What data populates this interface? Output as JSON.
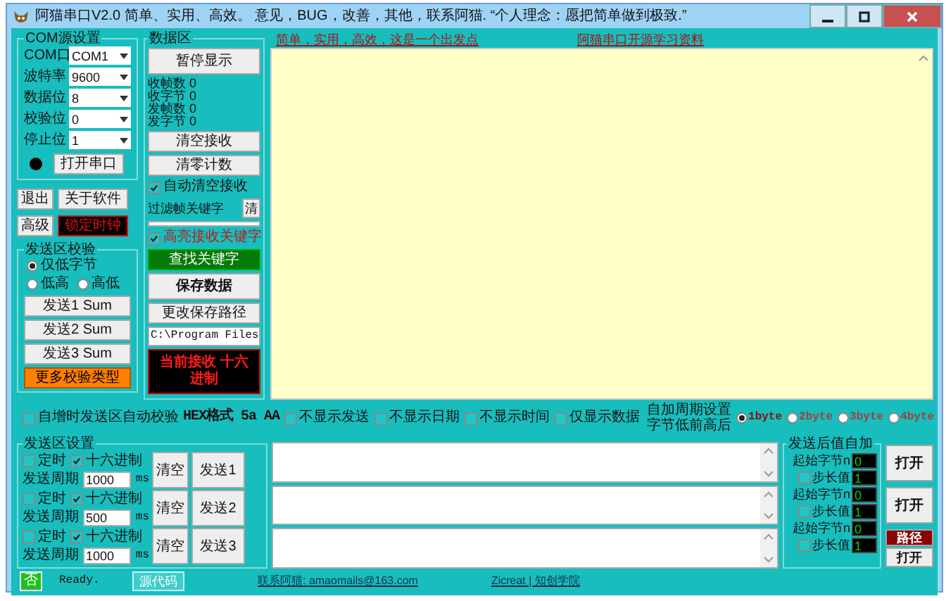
{
  "window": {
    "title": "阿猫串口V2.0  简单、实用、高效。  意见，BUG，改善，其他，联系阿猫. “个人理念：愿把简单做到极致.”"
  },
  "header_links": [
    "简单，实用，高效，这是一个出发点",
    "阿猫串口开源学习资料"
  ],
  "com_settings": {
    "title": "COM源设置",
    "fields": [
      {
        "label": "COM口",
        "value": "COM1"
      },
      {
        "label": "波特率",
        "value": "9600"
      },
      {
        "label": "数据位",
        "value": "8"
      },
      {
        "label": "校验位",
        "value": "0"
      },
      {
        "label": "停止位",
        "value": "1"
      }
    ],
    "port_open": false,
    "open_button": "打开串口"
  },
  "exit_button": "退出",
  "about_button": "关于软件",
  "advanced_button": "高级",
  "lock_clock_button": "锁定时钟",
  "checksum": {
    "title": "发送区校验",
    "options": [
      {
        "label": "仅低字节",
        "selected": true
      },
      {
        "label": "低高",
        "selected": false
      },
      {
        "label": "高低",
        "selected": false
      }
    ],
    "buttons": [
      "发送1 Sum",
      "发送2 Sum",
      "发送3 Sum"
    ],
    "more_button": "更多校验类型"
  },
  "data_area": {
    "title": "数据区",
    "pause_button": "暂停显示",
    "counters": [
      "收帧数 0",
      "收字节 0",
      "发帧数 0",
      "发字节 0"
    ],
    "clear_receive_button": "清空接收",
    "reset_count_button": "清零计数",
    "auto_clear": {
      "label": "自动清空接收",
      "checked": true
    },
    "filter_label": "过滤帧关键字",
    "filter_clear_button": "清",
    "highlight": {
      "label": "高亮接收关键字",
      "checked": true
    },
    "find_button": "查找关键字",
    "save_button": "保存数据",
    "change_path_button": "更改保存路径",
    "path_value": "C:\\Program Files",
    "receive_mode": "当前接收 十六进制"
  },
  "options_row": [
    {
      "kind": "checkbox",
      "label": "自增时发送区自动校验",
      "checked": false
    },
    {
      "kind": "text",
      "label": "HEX格式 5a AA"
    },
    {
      "kind": "checkbox",
      "label": "不显示发送",
      "checked": false
    },
    {
      "kind": "checkbox",
      "label": "不显示日期",
      "checked": false
    },
    {
      "kind": "checkbox",
      "label": "不显示时间",
      "checked": false
    },
    {
      "kind": "checkbox",
      "label": "仅显示数据",
      "checked": false
    }
  ],
  "auto_inc_setting": [
    "自加周期设置",
    "字节低前高后"
  ],
  "byte_options": [
    {
      "label": "1byte",
      "selected": true
    },
    {
      "label": "2byte",
      "selected": false
    },
    {
      "label": "3byte",
      "selected": false
    },
    {
      "label": "4byte",
      "selected": false
    }
  ],
  "send_settings": {
    "title": "发送区设置",
    "rows": [
      {
        "timer": {
          "label": "定时",
          "checked": false
        },
        "hex": {
          "label": "十六进制",
          "checked": true
        },
        "period_label": "发送周期",
        "period": "1000",
        "unit": "ms",
        "clear_button": "清空",
        "send_button": "发送1"
      },
      {
        "timer": {
          "label": "定时",
          "checked": false
        },
        "hex": {
          "label": "十六进制",
          "checked": true
        },
        "period_label": "发送周期",
        "period": "500",
        "unit": "ms",
        "clear_button": "清空",
        "send_button": "发送2"
      },
      {
        "timer": {
          "label": "定时",
          "checked": false
        },
        "hex": {
          "label": "十六进制",
          "checked": true
        },
        "period_label": "发送周期",
        "period": "1000",
        "unit": "ms",
        "clear_button": "清空",
        "send_button": "发送3"
      }
    ]
  },
  "auto_increment": {
    "title": "发送后值自加",
    "rows": [
      {
        "start_label": "起始字节n",
        "start_value": "0",
        "step": {
          "label": "步长值",
          "checked": false
        },
        "step_value": "1"
      },
      {
        "start_label": "起始字节n",
        "start_value": "0",
        "step": {
          "label": "步长值",
          "checked": false
        },
        "step_value": "1"
      },
      {
        "start_label": "起始字节n",
        "start_value": "0",
        "step": {
          "label": "步长值",
          "checked": false
        },
        "step_value": "1"
      }
    ]
  },
  "open_buttons": [
    "打开",
    "打开",
    "打开"
  ],
  "path_button": "路径",
  "status_bar": {
    "indicator": "否",
    "status": "Ready.",
    "code_button": "源代码",
    "contact": "联系阿猫: amaomails@163.com",
    "link": "Zicreat | 知创学院"
  }
}
